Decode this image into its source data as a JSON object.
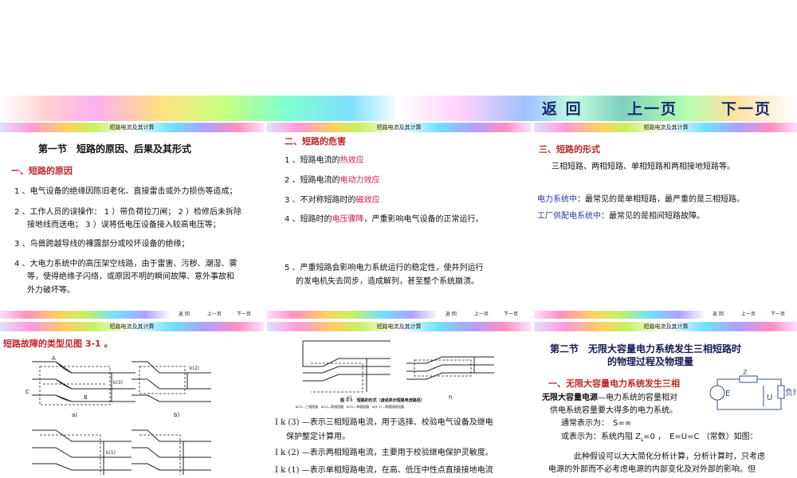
{
  "nav": {
    "back": "返 回",
    "prev": "上一页",
    "next": "下一页"
  },
  "strip_title": "短路电流及其计算",
  "footer": {
    "back": "返 回",
    "prev": "上一页",
    "next": "下一页"
  },
  "p1": {
    "title": "第一节　短路的原因、后果及其形式",
    "subtitle": "一、短路的原因",
    "item1": "1 、电气设备的绝缘因陈旧老化、直接雷击或外力损伤等造成；",
    "item2a": "2 、工作人员的误操作： 1 ）带负荷拉刀闸； 2 ）检修后未拆除",
    "item2b": "接地线而送电； 3 ）误将低电压设备接入较高电压等；",
    "item3": "3 、鸟兽跨越导线的裸露部分或咬坏设备的绝缘；",
    "item4a": "4 、大电力系统中的高压架空线路，由于雷害、污秽、潮湿、雾",
    "item4b": "等，使得绝缘子闪络，或原因不明的瞬间故障、意外事故和",
    "item4c": "外力破坏等。"
  },
  "p2": {
    "title": "二、短路的危害",
    "i1_pre": "1 、短路电流的",
    "i1_hl": "热效应",
    "i2_pre": "2 、短路电流的",
    "i2_hl": "电动力效应",
    "i3_pre": "3 、不对称短路时的",
    "i3_hl": "磁效应",
    "i4_pre": "4 、短路时的",
    "i4_hl": "电压骤降",
    "i4_post": "，严重影响电气设备的正常运行。",
    "i5a": "5 、严重短路会影响电力系统运行的稳定性，使并列运行",
    "i5b": "的发电机失去同步，造成解列，甚至整个系统崩溃。"
  },
  "p3": {
    "title": "三、短路的形式",
    "line1": "三相短路、两相短路、单相短路和两相接地短路等。",
    "l2_label": "电力系统中",
    "l2_text": "：最常见的是单相短路，最严重的是三相短路。",
    "l3_label": "工厂供配电系统中",
    "l3_text": "：最常见的是相间短路故障。"
  },
  "p4": {
    "title": "短路故障的类型见图 3-1 。",
    "fig_a": "a)",
    "fig_b": "b)",
    "lbl_A": "A",
    "lbl_B": "B",
    "lbl_C": "C",
    "k3": "k(3)",
    "k2": "k(2)",
    "k1": "k(1)"
  },
  "p5": {
    "fig_caption": "图 3-1　短路的形式（虚线表示短路电流路径）",
    "fig_sub": "k(3)—三相短路　k(2)—两相短路　k(1)—单相短路　k(1,1)—两相接地短路",
    "fig_e": "e)",
    "fig_f": "f)",
    "l1": "I k (3) —表示三相短路电流，用于选择、校验电气设备及继电",
    "l1b": "保护整定计算用。",
    "l2": "I k (2) —表示两相短路电流，主要用于校验继电保护灵敏度。",
    "l3": "I k (1) —表示单相短路电流，在高、低压中性点直接接地电流"
  },
  "p6": {
    "title1": "第二节　无限大容量电力系统发生三相短路时",
    "title2": "的物理过程及物理量",
    "sub": "一、无限大容量电力系统发生三相",
    "l1_bold": "无限大容量电源",
    "l1_text": "—电力系统的容量相对",
    "l2": "供电系统容量要大得多的电力系统。",
    "l3": "通常表示为：　S=∞",
    "l4": "或表示为：系统内阻 Z",
    "l4b": "=0 ，　E=U=C （常数）如图：",
    "l5": "此种假设可以大大简化分析计算，分析计算时，只考虑",
    "l6": "电源的外部而不必考虑电源的内部变化及对外部的影响。但",
    "circ_z": "Z",
    "circ_e": "E",
    "circ_u": "U",
    "circ_load": "负载"
  }
}
